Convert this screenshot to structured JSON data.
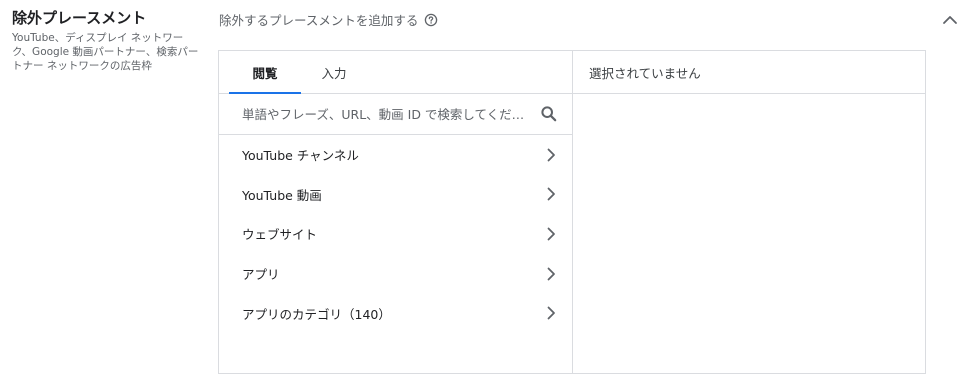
{
  "section": {
    "title": "除外プレースメント",
    "description": "YouTube、ディスプレイ ネットワーク、Google 動画パートナー、検索パートナー ネットワークの広告枠"
  },
  "header": {
    "label": "除外するプレースメントを追加する",
    "help_icon": "help-circle-icon",
    "collapse_icon": "chevron-up-icon"
  },
  "tabs": [
    {
      "label": "閲覧",
      "active": true
    },
    {
      "label": "入力",
      "active": false
    }
  ],
  "search": {
    "placeholder": "単語やフレーズ、URL、動画 ID で検索してくだ…",
    "icon": "search-icon"
  },
  "list": [
    {
      "label": "YouTube チャンネル"
    },
    {
      "label": "YouTube 動画"
    },
    {
      "label": "ウェブサイト"
    },
    {
      "label": "アプリ"
    },
    {
      "label": "アプリのカテゴリ（140）"
    }
  ],
  "selected_panel": {
    "empty_label": "選択されていません"
  },
  "colors": {
    "accent": "#1a73e8",
    "border": "#dadce0",
    "text": "#202124",
    "secondary_text": "#5f6368"
  }
}
